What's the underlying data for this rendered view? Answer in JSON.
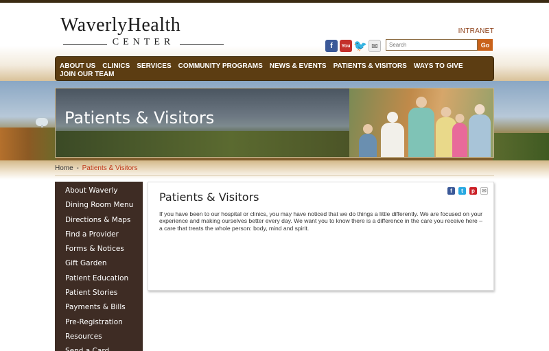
{
  "logo": {
    "main": "WaverlyHealth",
    "sub": "CENTER"
  },
  "header": {
    "intranet_label": "INTRANET",
    "search_placeholder": "Search",
    "search_button": "Go",
    "social_icons": [
      "facebook-icon",
      "youtube-icon",
      "twitter-icon",
      "email-icon"
    ]
  },
  "nav": {
    "items": [
      "ABOUT US",
      "CLINICS",
      "SERVICES",
      "COMMUNITY PROGRAMS",
      "NEWS & EVENTS",
      "PATIENTS & VISITORS",
      "WAYS TO GIVE",
      "JOIN OUR TEAM"
    ]
  },
  "hero": {
    "title": "Patients & Visitors"
  },
  "breadcrumb": {
    "home": "Home",
    "separator": "-",
    "current": "Patients & Visitors"
  },
  "sidebar": {
    "items": [
      "About Waverly",
      "Dining Room Menu",
      "Directions & Maps",
      "Find a Provider",
      "Forms & Notices",
      "Gift Garden",
      "Patient Education",
      "Patient Stories",
      "Payments & Bills",
      "Pre-Registration",
      "Resources",
      "Send a Card"
    ]
  },
  "content": {
    "title": "Patients & Visitors",
    "body": "If you have been to our hospital or clinics, you may have noticed that we do things a little differently. We are focused on your experience and making ourselves better every day. We want you to know there is a difference in the care you receive here – a care that treats the whole person: body, mind and spirit.",
    "share_icons": [
      "facebook-icon",
      "twitter-icon",
      "pinterest-icon",
      "email-icon"
    ]
  },
  "colors": {
    "nav_bg": "#5c3d12",
    "sidebar_bg": "#3e2c24",
    "accent": "#c9621a",
    "breadcrumb_current": "#c0391a"
  }
}
